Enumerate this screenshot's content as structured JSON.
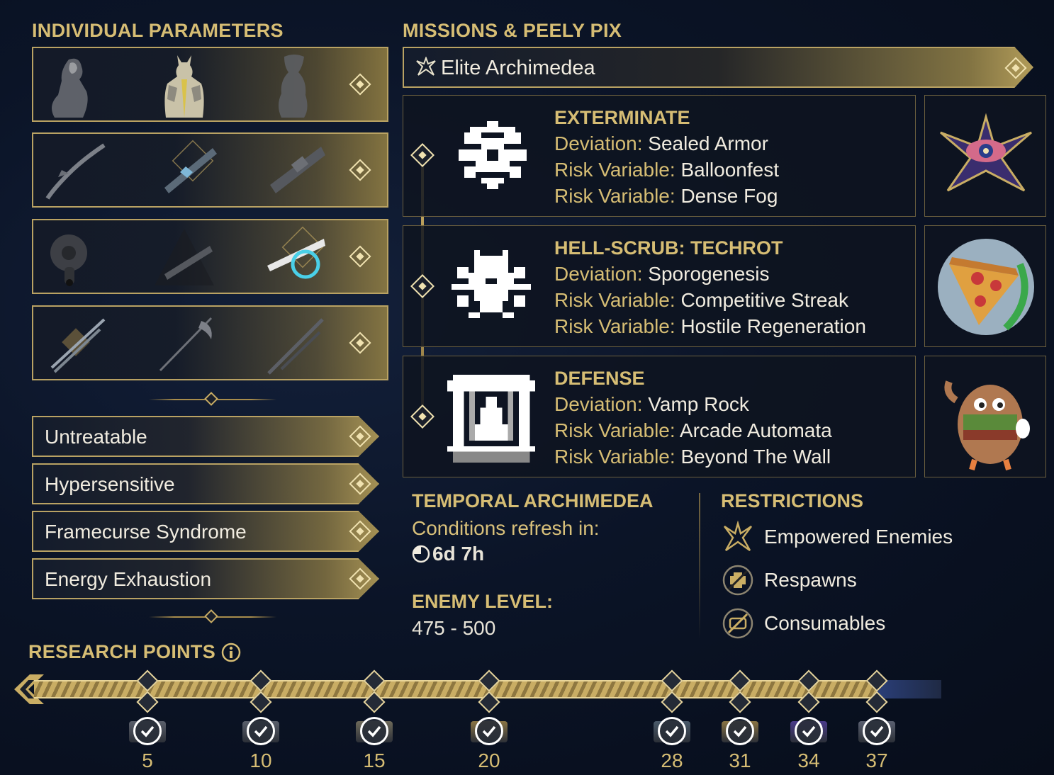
{
  "left": {
    "title": "INDIVIDUAL PARAMETERS",
    "loadouts": [
      {
        "slots": [
          "warframe-1",
          "warframe-2",
          "warframe-3"
        ]
      },
      {
        "slots": [
          "primary-1",
          "primary-2",
          "primary-3"
        ]
      },
      {
        "slots": [
          "secondary-1",
          "secondary-2",
          "secondary-3"
        ]
      },
      {
        "slots": [
          "melee-1",
          "melee-2",
          "melee-3"
        ]
      }
    ],
    "modifiers": [
      "Untreatable",
      "Hypersensitive",
      "Framecurse Syndrome",
      "Energy Exhaustion"
    ]
  },
  "missions": {
    "title": "MISSIONS & PEELY PIX",
    "header_label": "Elite Archimedea",
    "deviation_label": "Deviation:",
    "risk_label": "Risk Variable:",
    "list": [
      {
        "title": "EXTERMINATE",
        "deviation": "Sealed Armor",
        "risks": [
          "Balloonfest",
          "Dense Fog"
        ],
        "reward_icon": "eye-sigil-icon"
      },
      {
        "title": "HELL-SCRUB: TECHROT",
        "deviation": "Sporogenesis",
        "risks": [
          "Competitive Streak",
          "Hostile Regeneration"
        ],
        "reward_icon": "pizza-icon"
      },
      {
        "title": "DEFENSE",
        "deviation": "Vamp Rock",
        "risks": [
          "Arcade Automata",
          "Beyond The Wall"
        ],
        "reward_icon": "mascot-icon"
      }
    ]
  },
  "temporal": {
    "title": "TEMPORAL ARCHIMEDEA",
    "refresh_label": "Conditions refresh in:",
    "refresh_value": "6d 7h",
    "enemy_level_label": "ENEMY LEVEL:",
    "enemy_level_value": "475 - 500"
  },
  "restrictions": {
    "title": "RESTRICTIONS",
    "items": [
      "Empowered Enemies",
      "Respawns",
      "Consumables"
    ]
  },
  "research": {
    "title": "RESEARCH POINTS",
    "progress_fraction": 0.93,
    "milestones": [
      "5",
      "10",
      "15",
      "20",
      "28",
      "31",
      "34",
      "37"
    ]
  },
  "colors": {
    "gold": "#d6bd74",
    "background": "#0b1427",
    "text": "#f1ece0"
  }
}
